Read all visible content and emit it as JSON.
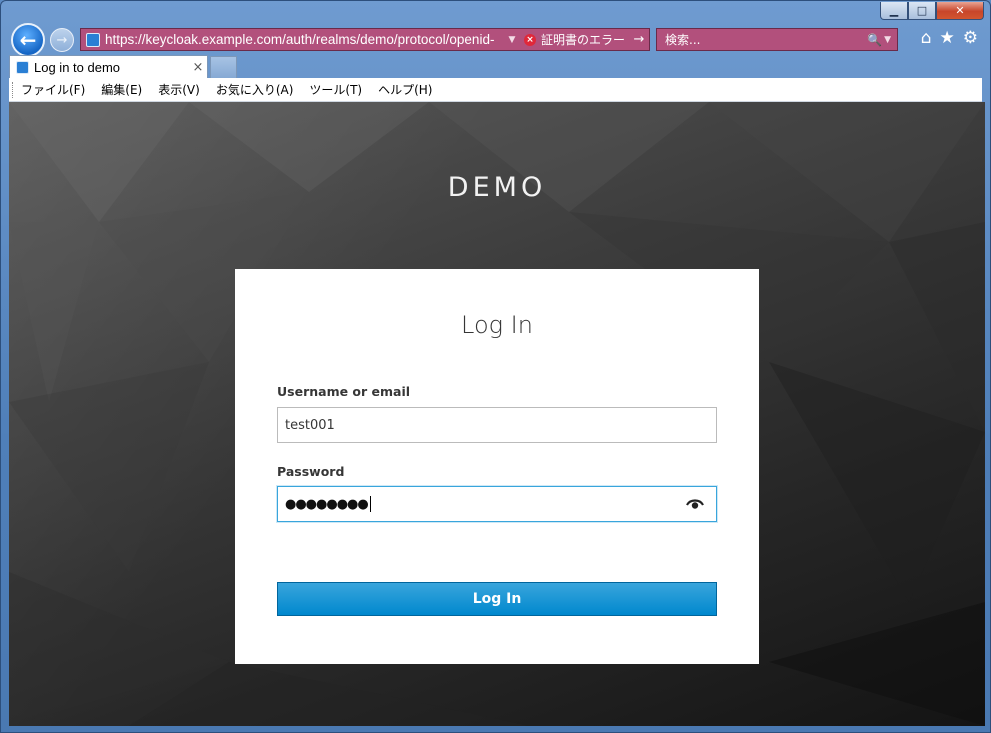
{
  "window": {
    "minimize": "▁",
    "maximize": "□",
    "close": "✕"
  },
  "nav": {
    "back_glyph": "←",
    "forward_glyph": "→",
    "url": "https://keycloak.example.com/auth/realms/demo/protocol/openid-",
    "addr_dropdown": "▼",
    "cert_error_icon": "×",
    "cert_error": "証明書のエラー",
    "go_glyph": "→",
    "search_placeholder": "検索...",
    "search_icon": "🔍",
    "search_dropdown": "▼",
    "home_icon": "⌂",
    "favorites_icon": "★",
    "tools_icon": "⚙"
  },
  "tab": {
    "label": "Log in to demo",
    "close": "×"
  },
  "menu": {
    "items": [
      "ファイル(F)",
      "編集(E)",
      "表示(V)",
      "お気に入り(A)",
      "ツール(T)",
      "ヘルプ(H)"
    ]
  },
  "page": {
    "realm_title": "DEMO",
    "card_title": "Log In",
    "username_label": "Username or email",
    "username_value": "test001",
    "password_label": "Password",
    "password_mask": "●●●●●●●●",
    "login_button": "Log In"
  },
  "colors": {
    "accent": "#0088ce",
    "address_bar_error": "#b2507c",
    "focus_border": "#39a5dc"
  }
}
